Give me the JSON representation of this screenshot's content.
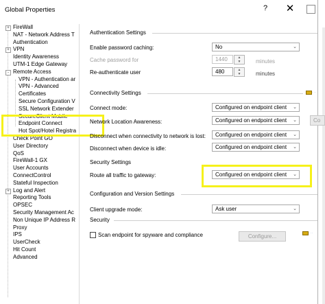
{
  "window": {
    "title": "Global Properties",
    "help_label": "?",
    "close_label": "✕"
  },
  "tree": {
    "items": [
      {
        "label": "FireWall",
        "expander": "+"
      },
      {
        "label": "NAT - Network Address T"
      },
      {
        "label": "Authentication"
      },
      {
        "label": "VPN",
        "expander": "+"
      },
      {
        "label": "Identity Awareness"
      },
      {
        "label": "UTM-1 Edge Gateway"
      },
      {
        "label": "Remote Access",
        "expander": "-"
      },
      {
        "label": "VPN - Authentication ar"
      },
      {
        "label": "VPN - Advanced"
      },
      {
        "label": "Certificates"
      },
      {
        "label": "Secure Configuration V"
      },
      {
        "label": "SSL Network Extender"
      },
      {
        "label": "SecureClient Mobile"
      },
      {
        "label": "Endpoint Connect"
      },
      {
        "label": "Hot Spot/Hotel Registra"
      },
      {
        "label": "Check Point GO"
      },
      {
        "label": "User Directory"
      },
      {
        "label": "QoS"
      },
      {
        "label": "FireWall-1 GX"
      },
      {
        "label": "User Accounts"
      },
      {
        "label": "ConnectControl"
      },
      {
        "label": "Stateful Inspection"
      },
      {
        "label": "Log and Alert",
        "expander": "+"
      },
      {
        "label": "Reporting Tools"
      },
      {
        "label": "OPSEC"
      },
      {
        "label": "Security Management Ac"
      },
      {
        "label": "Non Unique IP Address R"
      },
      {
        "label": "Proxy"
      },
      {
        "label": "IPS"
      },
      {
        "label": "UserCheck"
      },
      {
        "label": "Hit Count"
      },
      {
        "label": "Advanced"
      }
    ]
  },
  "auth": {
    "title": "Authentication Settings",
    "enable_caching_label": "Enable password caching:",
    "enable_caching_value": "No",
    "cache_password_label": "Cache password for",
    "cache_password_value": "1440",
    "cache_password_unit": "minutes",
    "reauth_label": "Re-authenticate user",
    "reauth_value": "480",
    "reauth_unit": "minutes"
  },
  "connectivity": {
    "title": "Connectivity Settings",
    "connect_mode_label": "Connect mode:",
    "connect_mode_value": "Configured on endpoint client",
    "nla_label": "Network Location Awareness:",
    "nla_value": "Configured on endpoint client",
    "nla_button": "Co",
    "disc_lost_label": "Disconnect when connectivity to network is lost:",
    "disc_lost_value": "Configured on endpoint client",
    "disc_idle_label": "Disconnect when device is idle:",
    "disc_idle_value": "Configured on endpoint client"
  },
  "security": {
    "title": "Security Settings",
    "route_label": "Route all traffic to gateway:",
    "route_value": "Configured on endpoint client"
  },
  "config_version": {
    "title": "Configuration and Version Settings",
    "upgrade_label": "Client upgrade mode:",
    "upgrade_value": "Ask user"
  },
  "security2": {
    "title": "Security",
    "scan_label": "Scan endpoint for spyware and compliance",
    "configure_button": "Configure..."
  },
  "colors": {
    "highlight": "#f6f11a",
    "note_icon": "#d7ac14",
    "disabled_text": "#9d9d9d"
  },
  "icons": [
    "help-icon",
    "close-icon",
    "note-icon",
    "dropdown-arrow-icon",
    "spin-icon",
    "expand-icon"
  ]
}
